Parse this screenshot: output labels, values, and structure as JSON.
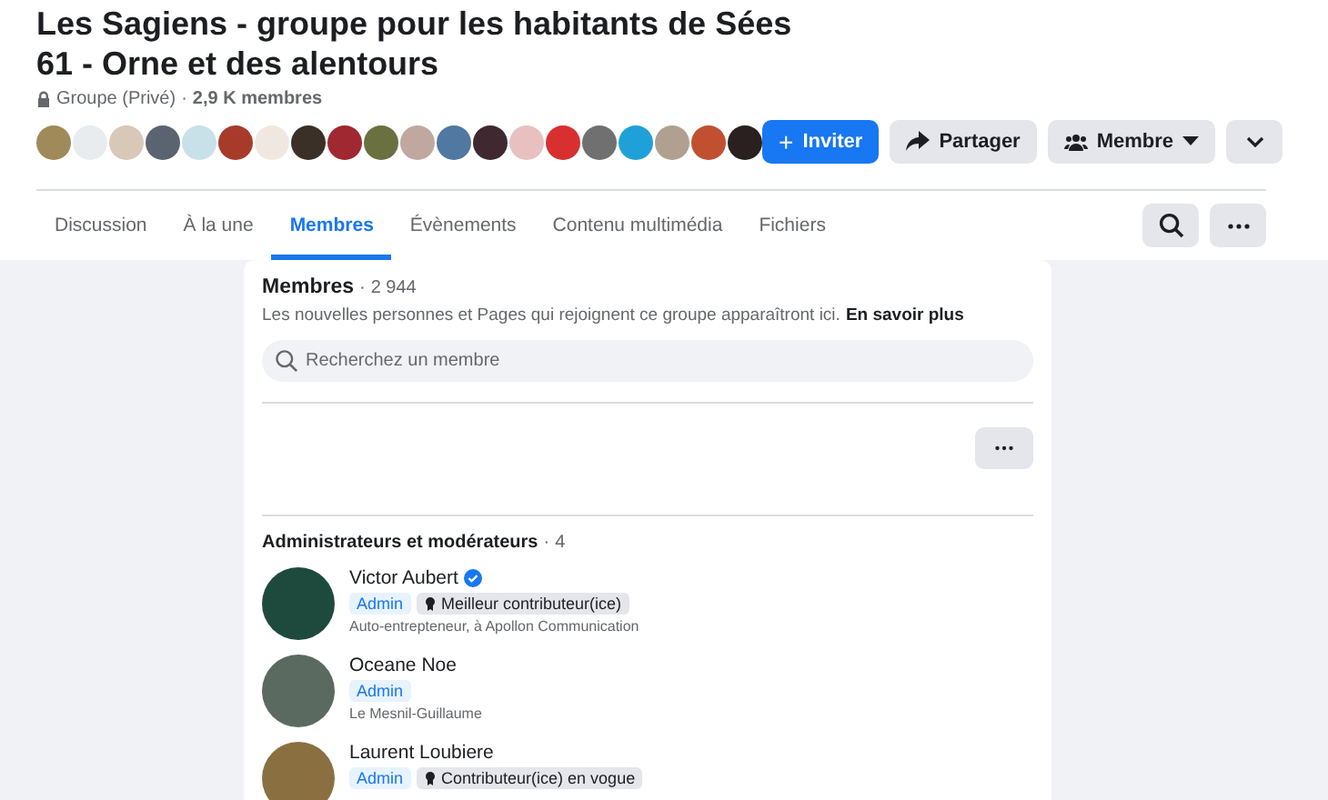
{
  "group": {
    "title": "Les Sagiens - groupe pour les habitants de Sées 61 - Orne et des alentours",
    "privacy": "Groupe (Privé)",
    "separator": "·",
    "member_count": "2,9 K membres"
  },
  "member_avatars": [
    {
      "color": "#a08a5a"
    },
    {
      "color": "#e8ecef"
    },
    {
      "color": "#d8c8b8"
    },
    {
      "color": "#5a6470"
    },
    {
      "color": "#c8e0e8"
    },
    {
      "color": "#a83a2a"
    },
    {
      "color": "#f0e8e0"
    },
    {
      "color": "#3a3028"
    },
    {
      "color": "#a02830"
    },
    {
      "color": "#6a7040"
    },
    {
      "color": "#c0a8a0"
    },
    {
      "color": "#5078a0"
    },
    {
      "color": "#402830"
    },
    {
      "color": "#e8c0c0"
    },
    {
      "color": "#d83030"
    },
    {
      "color": "#707070"
    },
    {
      "color": "#20a0d8"
    },
    {
      "color": "#b0a090"
    },
    {
      "color": "#c05030"
    },
    {
      "color": "#2a2020"
    }
  ],
  "actions": [
    {
      "kind": "primary",
      "icon": "+",
      "label": "Inviter"
    },
    {
      "kind": "share",
      "label": "Partager"
    },
    {
      "kind": "member",
      "label": "Membre"
    },
    {
      "kind": "more"
    }
  ],
  "tabs": [
    {
      "label": "Discussion",
      "selected": false
    },
    {
      "label": "À la une",
      "selected": false
    },
    {
      "label": "Membres",
      "selected": true
    },
    {
      "label": "Évènements",
      "selected": false
    },
    {
      "label": "Contenu multimédia",
      "selected": false
    },
    {
      "label": "Fichiers",
      "selected": false
    }
  ],
  "members": {
    "heading": "Membres",
    "separator": "·",
    "count": "2 944",
    "notice": "Les nouvelles personnes et Pages qui rejoignent ce groupe apparaîtront ici.",
    "learn_more": "En savoir plus",
    "search": {
      "placeholder": "Recherchez un membre"
    }
  },
  "admins": {
    "heading": "Administrateurs et modérateurs",
    "separator": "·",
    "count": "4",
    "people": [
      {
        "name": "Victor Aubert",
        "verified": true,
        "color": "#1e4a3e",
        "role": "Admin",
        "badge": "Meilleur contributeur(ice)",
        "subtitle": "Auto-entrepteneur, à Apollon Communication"
      },
      {
        "name": "Oceane Noe",
        "verified": false,
        "color": "#5a6a60",
        "role": "Admin",
        "subtitle": "Le Mesnil-Guillaume"
      },
      {
        "name": "Laurent Loubiere",
        "verified": false,
        "color": "#8a7040",
        "role": "Admin",
        "badge": "Contributeur(ice) en vogue"
      }
    ]
  }
}
